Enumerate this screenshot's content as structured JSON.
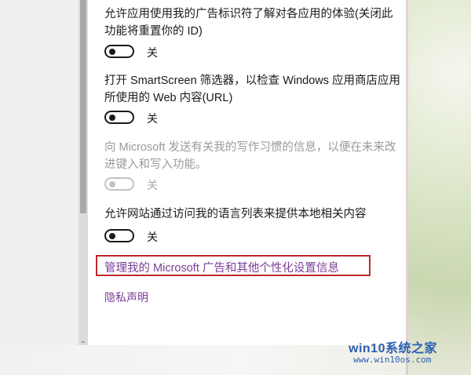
{
  "settings": [
    {
      "description": "允许应用使用我的广告标识符了解对各应用的体验(关闭此功能将重置你的 ID)",
      "toggle_label": "关",
      "state": "off",
      "enabled": true
    },
    {
      "description": "打开 SmartScreen 筛选器，以检查 Windows 应用商店应用所使用的 Web 内容(URL)",
      "toggle_label": "关",
      "state": "off",
      "enabled": true
    },
    {
      "description": "向 Microsoft 发送有关我的写作习惯的信息，以便在未来改进键入和写入功能。",
      "toggle_label": "关",
      "state": "off",
      "enabled": false
    },
    {
      "description": "允许网站通过访问我的语言列表来提供本地相关内容",
      "toggle_label": "关",
      "state": "off",
      "enabled": true
    }
  ],
  "links": {
    "manage": "管理我的 Microsoft 广告和其他个性化设置信息",
    "privacy": "隐私声明"
  },
  "watermark": {
    "logo": "win10系统之家",
    "url": "www.win10os.com"
  },
  "colors": {
    "link": "#7a3d96",
    "highlight_box": "#c0282d",
    "toggle_on": "#1a1a1a",
    "disabled": "#a8a8a8"
  }
}
